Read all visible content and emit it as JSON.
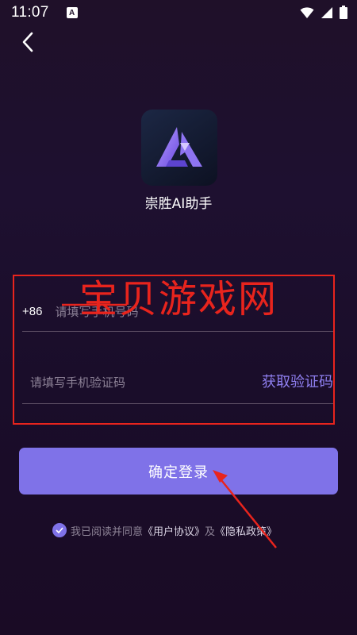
{
  "status_bar": {
    "time": "11:07",
    "notification_badge": "A",
    "icons": [
      "wifi-icon",
      "signal-icon",
      "battery-icon"
    ]
  },
  "nav": {
    "back_icon": "chevron-left-icon"
  },
  "app": {
    "name": "崇胜AI助手",
    "logo_icon": "triangle-logo-icon"
  },
  "form": {
    "country_code": "+86",
    "phone_placeholder": "请填写手机号码",
    "code_placeholder": "请填写手机验证码",
    "get_code_label": "获取验证码"
  },
  "login_button": {
    "label": "确定登录"
  },
  "agreement": {
    "checked": true,
    "prefix": "我已阅读并同意",
    "user_agreement": "《用户协议》",
    "conjunction": "及",
    "privacy_policy": "《隐私政策》"
  },
  "watermark": {
    "text": "宝贝游戏网"
  },
  "colors": {
    "accent": "#7f72e8",
    "link_accent": "#8f7ff0",
    "background_top": "#1f1029",
    "annotation_red": "#e8241d"
  }
}
